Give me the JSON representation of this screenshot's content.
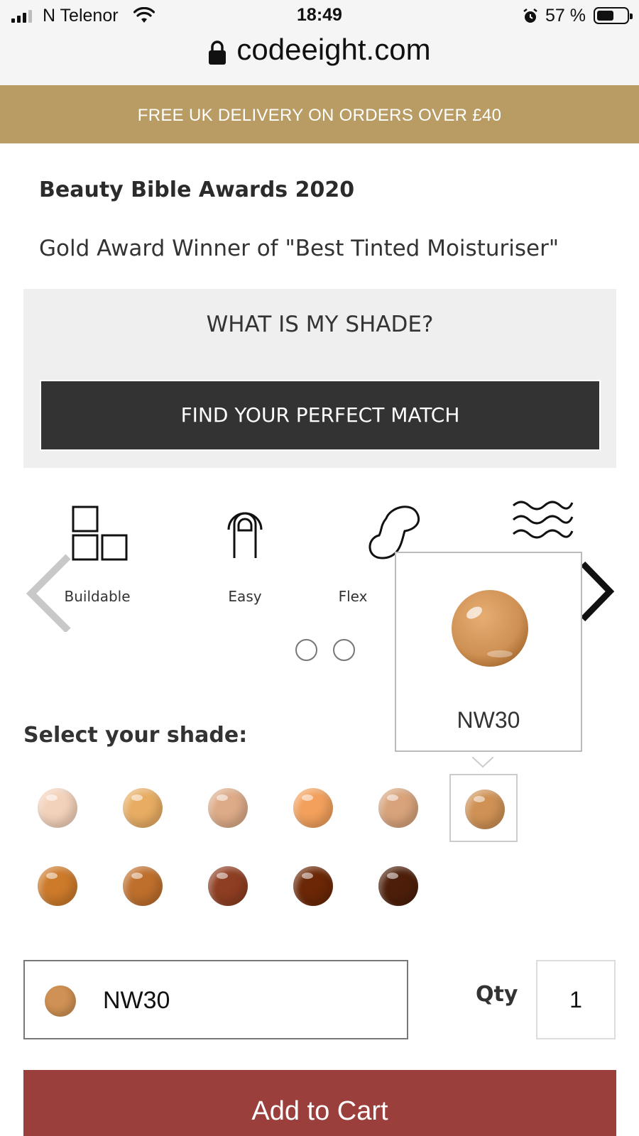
{
  "status_bar": {
    "carrier": "N Telenor",
    "time": "18:49",
    "battery_percent": "57 %",
    "battery_level": 0.57
  },
  "browser": {
    "url": "codeeight.com"
  },
  "promo": {
    "text": "FREE UK DELIVERY ON ORDERS OVER £40",
    "color": "#b89c63"
  },
  "award": {
    "title": "Beauty Bible Awards 2020",
    "text": "Gold Award Winner of \"Best Tinted Moisturiser\""
  },
  "shade_finder": {
    "question": "WHAT IS MY SHADE?",
    "button_label": "FIND YOUR PERFECT MATCH"
  },
  "features": [
    {
      "label": "Buildable",
      "icon": "squares-icon"
    },
    {
      "label": "Easy",
      "icon": "finger-icon"
    },
    {
      "label": "Flex",
      "icon": "blob-icon"
    },
    {
      "label": "",
      "icon": "waves-icon"
    }
  ],
  "carousel": {
    "page_count": 2
  },
  "tooltip": {
    "shade_name": "NW30",
    "swatch_color": "#cf9154"
  },
  "shade_select": {
    "label": "Select your shade:",
    "selected": "NW30",
    "selected_color": "#cf9154",
    "swatches": [
      {
        "color": "#f3d2bb"
      },
      {
        "color": "#e8ad63"
      },
      {
        "color": "#ddab88"
      },
      {
        "color": "#f2a05c"
      },
      {
        "color": "#d8a37b"
      },
      {
        "color": "#cf9154",
        "selected": true
      },
      {
        "color": "#cd7a2a"
      },
      {
        "color": "#bf6f2c"
      },
      {
        "color": "#8e3e22"
      },
      {
        "color": "#6b2706"
      },
      {
        "color": "#4d1f0a"
      }
    ]
  },
  "quantity": {
    "label": "Qty",
    "value": "1"
  },
  "cart": {
    "button_label": "Add to Cart",
    "color": "#9b3f3c"
  }
}
